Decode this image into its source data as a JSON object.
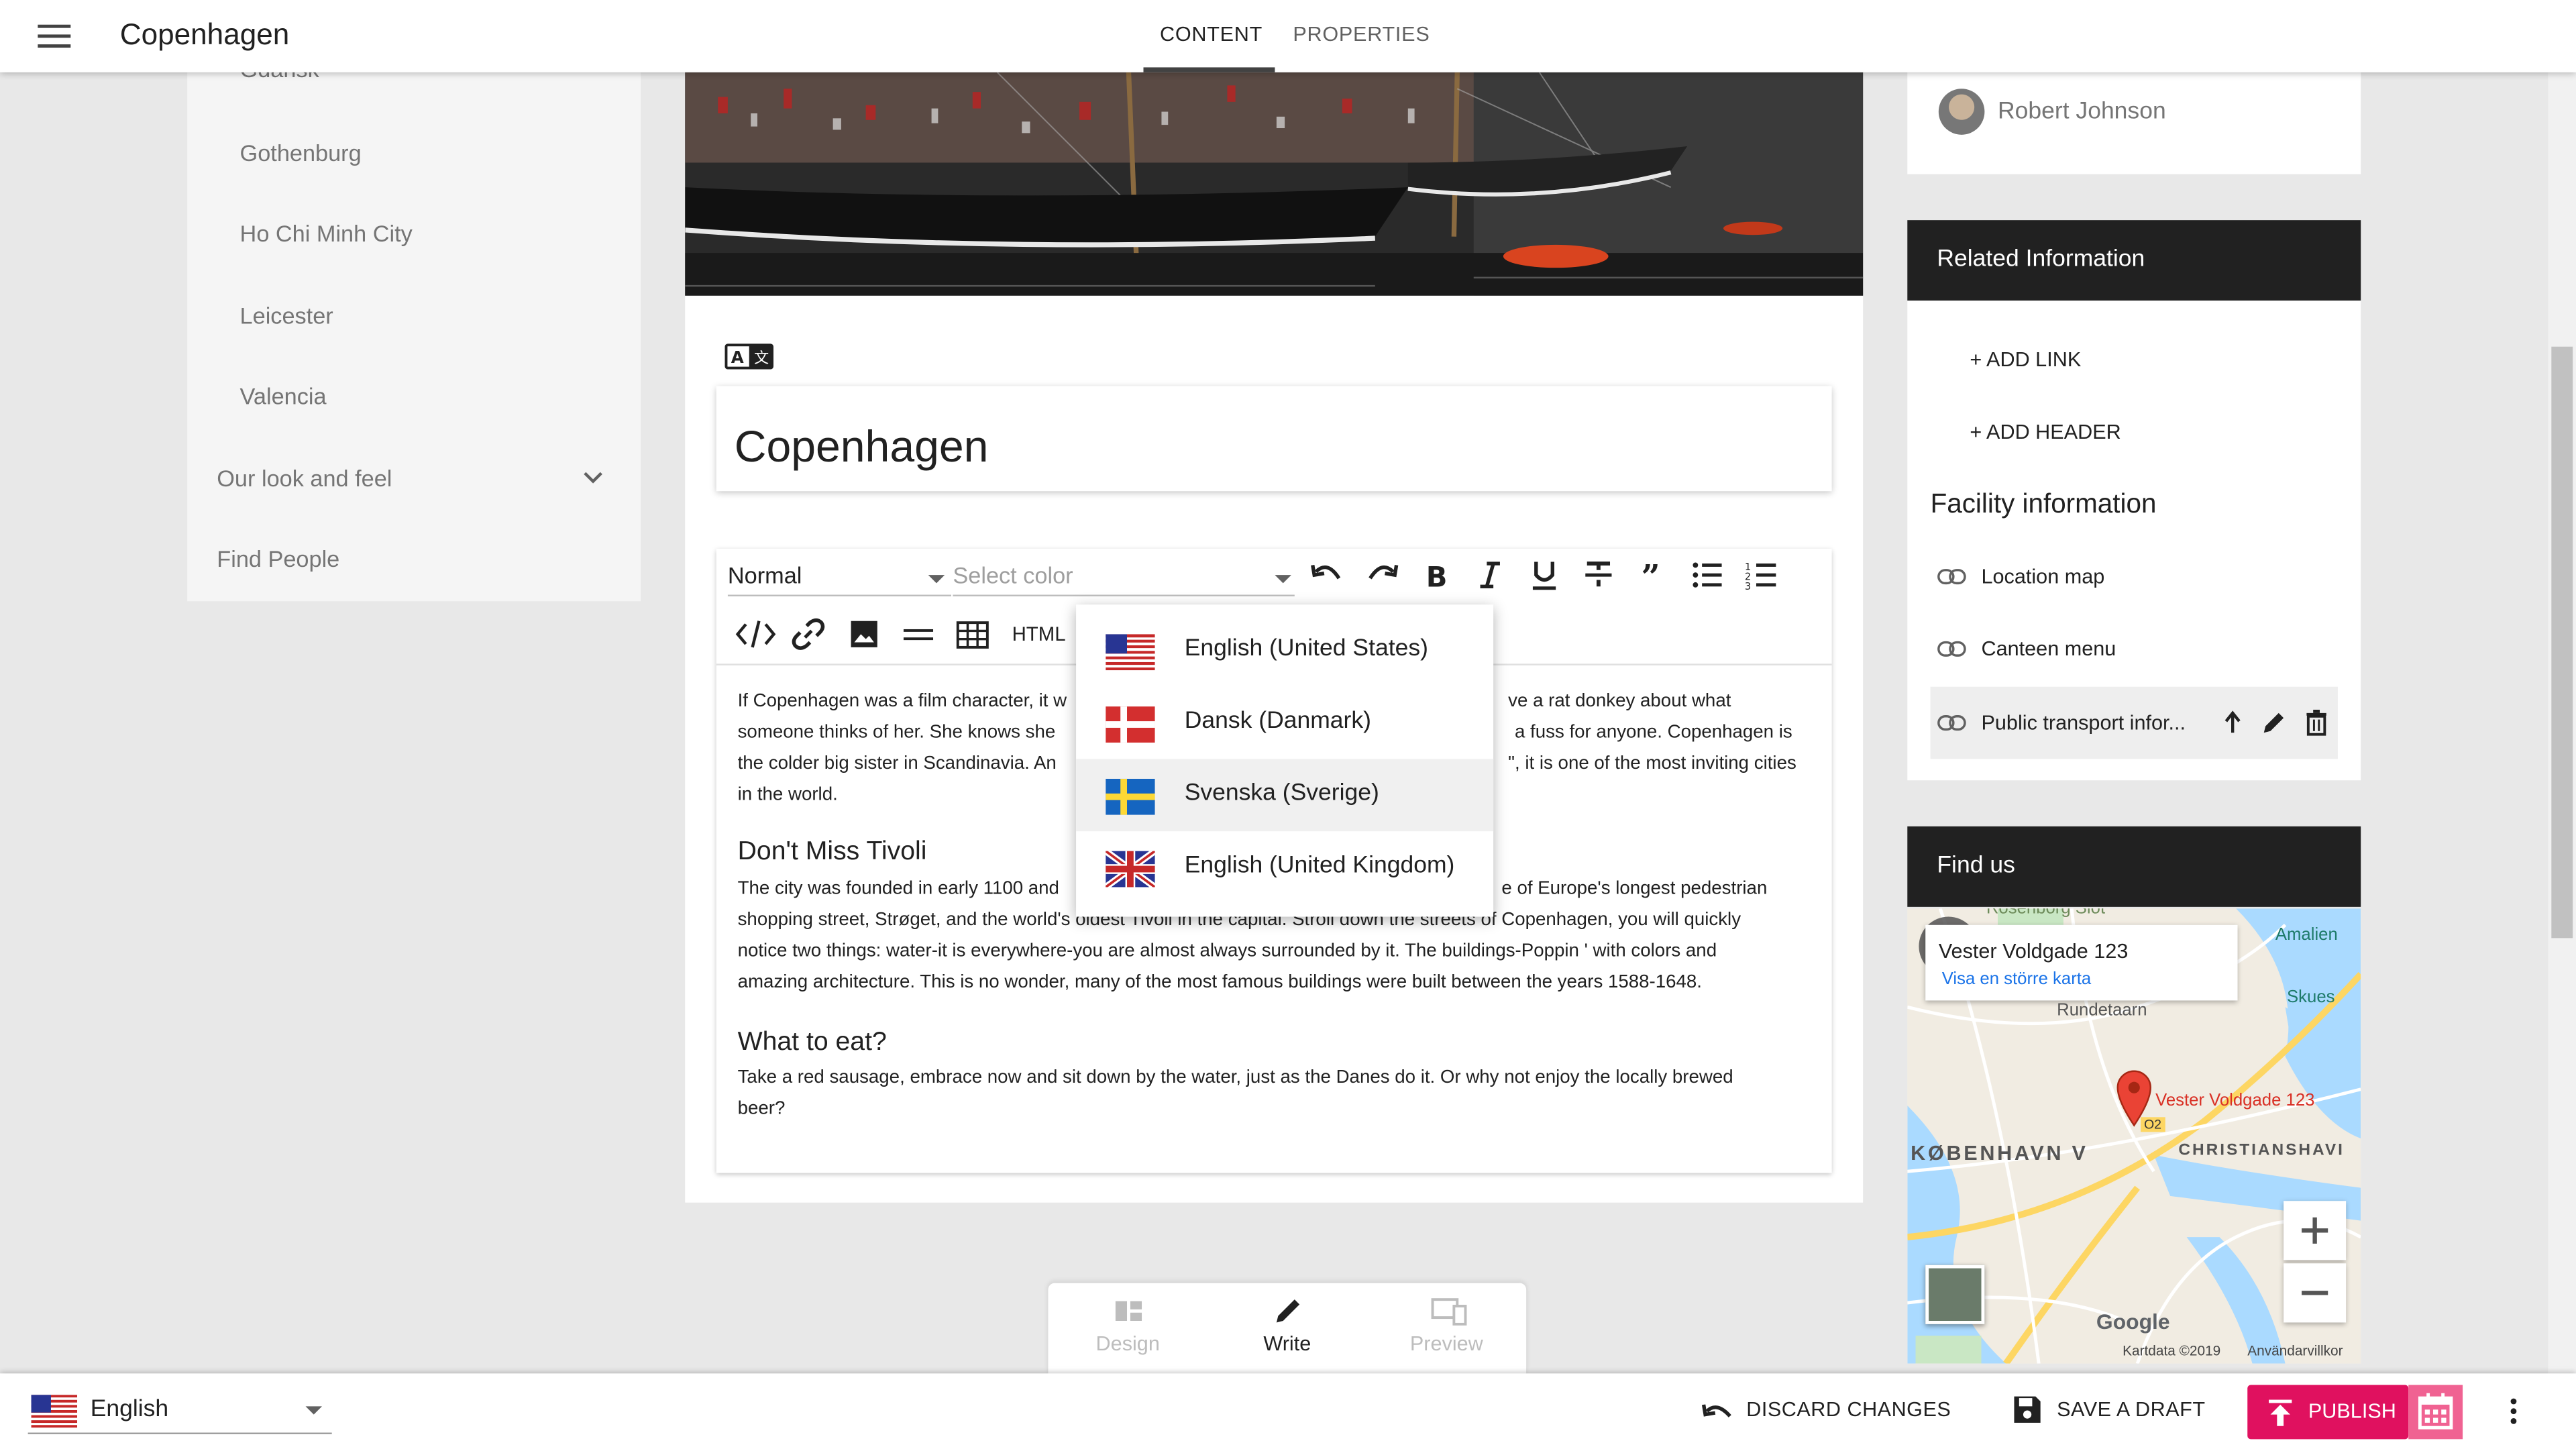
{
  "header": {
    "title": "Copenhagen",
    "tabs": [
      "CONTENT",
      "PROPERTIES"
    ]
  },
  "sidebar": {
    "items": [
      {
        "label": "Gdansk"
      },
      {
        "label": "Gothenburg"
      },
      {
        "label": "Ho Chi Minh City"
      },
      {
        "label": "Leicester"
      },
      {
        "label": "Valencia"
      },
      {
        "label": "Our look and feel"
      },
      {
        "label": "Find People"
      }
    ]
  },
  "editor": {
    "title": "Copenhagen",
    "style_select": "Normal",
    "color_placeholder": "Select color",
    "html_label": "HTML",
    "paragraphs": [
      [
        "If Copenhagen was a film character, it w",
        "ve a rat donkey about what",
        "someone thinks of her. She knows she",
        "a fuss for anyone. Copenhagen is",
        "the colder big sister in Scandinavia. An",
        "\", it is one of the most inviting cities",
        "in the world."
      ],
      [
        "The city was founded in early 1100 and",
        "e of Europe's longest pedestrian",
        "shopping street, Strøget, and the world's oldest Tivoli in the capital. Stroll down the streets of Copenhagen, you will quickly",
        "notice two things: water-it is everywhere-you are almost always surrounded by it. The buildings-Poppin ' with colors and",
        "amazing architecture. This is no wonder, many of the most famous buildings were built between the years 1588-1648."
      ],
      [
        "Take a red sausage, embrace now and sit down by the water, just as the Danes do it. Or why not enjoy the locally brewed",
        "beer?"
      ]
    ],
    "headings": [
      "Don't Miss Tivoli",
      "What to eat?"
    ]
  },
  "language_menu": {
    "items": [
      "English (United States)",
      "Dansk (Danmark)",
      "Svenska (Sverige)",
      "English (United Kingdom)"
    ],
    "highlighted_index": 2
  },
  "modes": [
    "Design",
    "Write",
    "Preview"
  ],
  "right": {
    "author": "Robert Johnson",
    "related_header": "Related Information",
    "add_link": "+ ADD LINK",
    "add_header": "+ ADD HEADER",
    "facility_title": "Facility information",
    "links": [
      "Location map",
      "Canteen menu",
      "Public transport infor..."
    ],
    "find_us": "Find us"
  },
  "map": {
    "address": "Vester Voldgade 123",
    "larger_map": "Visa en större karta",
    "labels": {
      "rosenborg": "Rosenborg Slot",
      "amalien": "Amalien",
      "skues": "Skues",
      "rundetaarn": "Rundetaarn",
      "pin": "Vester Voldgade 123",
      "o2": "O2",
      "kobenhavn": "KØBENHAVN V",
      "christianshavn": "CHRISTIANSHAVI",
      "google": "Google",
      "kartdata": "Kartdata ©2019",
      "terms": "Användarvillkor"
    }
  },
  "bottombar": {
    "language": "English",
    "discard": "DISCARD CHANGES",
    "save_draft": "SAVE A DRAFT",
    "publish": "PUBLISH"
  },
  "colors": {
    "accent": "#e0115f",
    "header_dark": "#212121"
  }
}
